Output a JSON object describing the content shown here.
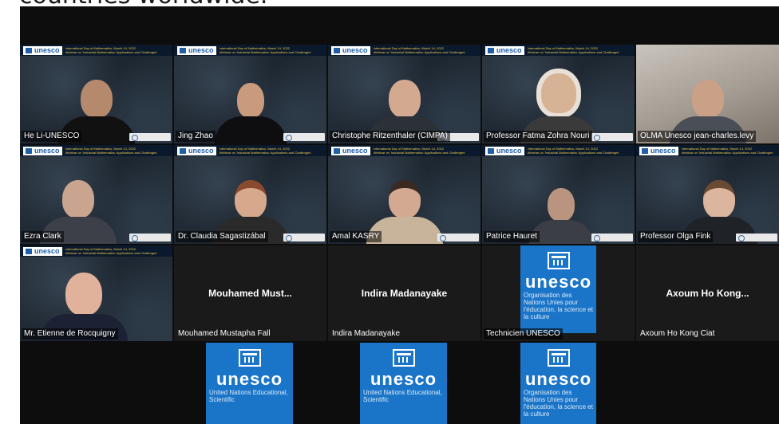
{
  "caption": "countries worldwide.",
  "banner": {
    "logo": "unesco",
    "event_line1": "International Day of Mathematics, March 14, 2022",
    "event_line2": "Webinar on 'Industrial Mathematics: Applications and Challenges'"
  },
  "participants": [
    {
      "name": "He Li-UNESCO"
    },
    {
      "name": "Jing Zhao"
    },
    {
      "name": "Christophe Ritzenthaler (CIMPA)"
    },
    {
      "name": "Professor Fatma Zohra Nouri"
    },
    {
      "name": "OLMA Unesco jean-charles.levy"
    },
    {
      "name": "Ezra Clark"
    },
    {
      "name": "Dr. Claudia Sagastizábal"
    },
    {
      "name": "Amal KASRY"
    },
    {
      "name": "Patrice Hauret"
    },
    {
      "name": "Professor Olga Fink"
    },
    {
      "name": "Mr. Etienne de Rocquigny"
    },
    {
      "name": "Mouhamed Mustapha Fall",
      "display": "Mouhamed  Must..."
    },
    {
      "name": "Indira Madanayake",
      "display": "Indira Madanayake"
    },
    {
      "name": "Technicien UNESCO"
    },
    {
      "name": "Axoum Ho Kong Ciat",
      "display": "Axoum  Ho  Kong..."
    }
  ],
  "unesco_cards": {
    "word": "unesco",
    "fr_text": "Organisation des Nations Unies pour l'éducation, la science et la culture",
    "en_text": "United Nations Educational, Scientific"
  },
  "colors": {
    "unesco_blue": "#1a75c8",
    "background": "#0d0d0d",
    "banner_text": "#f2c94c"
  }
}
